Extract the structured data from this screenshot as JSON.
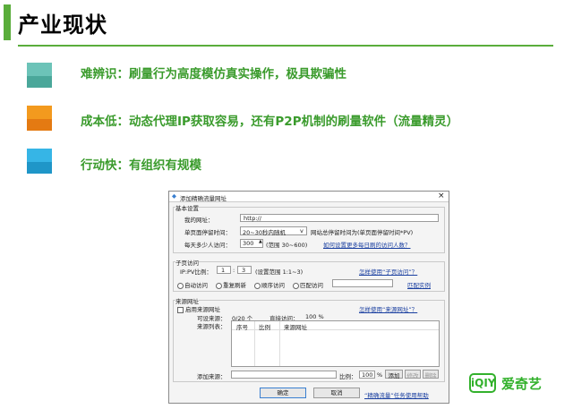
{
  "slide": {
    "title": "产业现状",
    "bullets": [
      {
        "text": "难辨识：刷量行为高度模仿真实操作，极具欺骗性",
        "color_top": "#6cc3b8",
        "color_bottom": "#4aa79a"
      },
      {
        "text": "成本低：动态代理IP获取容易，还有P2P机制的刷量软件（流量精灵）",
        "color_top": "#f39a1e",
        "color_bottom": "#e47a12"
      },
      {
        "text": "行动快：有组织有规模",
        "color_top": "#36b5e6",
        "color_bottom": "#1f96c8"
      }
    ],
    "accent": "#5aad3b"
  },
  "dialog": {
    "title": "添加精确流量网址",
    "close": "×",
    "basic": {
      "legend": "基本设置",
      "url_label": "我的网址：",
      "url_value": "http://",
      "stay_label": "单页面停留时间：",
      "stay_value": "20~30秒内随机",
      "stay_note": "网站总停留时间为(单页面停留时间*PV)",
      "visits_label": "每天多少人访问：",
      "visits_value": "300",
      "visits_range": "(范围 30~600)",
      "visits_link": "如何设置更多每日刷的访问人数？"
    },
    "sub": {
      "legend": "子页访问",
      "ipv_label": "IP:PV比例：",
      "ip_value": "1",
      "colon": ":",
      "pv_value": "3",
      "ipv_range": "(设置范围 1:1~3)",
      "howto_link": "怎样使用“子页访问”？",
      "radios": [
        "自动访问",
        "重复刷新",
        "顺序访问",
        "匹配访问"
      ],
      "match_link": "匹配实例"
    },
    "source": {
      "legend": "来源网址",
      "enable_label": "启用来源网址",
      "howto_link": "怎样使用“来源网址”？",
      "count_label": "可设来源：",
      "count_value": "0/20 个",
      "direct_label": "直接访问：",
      "direct_value": "100 %",
      "list_label": "来源列表：",
      "columns": [
        "序号",
        "比例",
        "来源网址"
      ],
      "add_label": "添加来源：",
      "ratio_label": "比例：",
      "ratio_value": "100",
      "ratio_unit": "%",
      "add_button": "添加",
      "modify_button": "修改",
      "delete_button": "删除"
    },
    "ok_button": "确定",
    "cancel_button": "取消",
    "help_link": "“精确流量”任务使用帮助"
  },
  "logo": {
    "box_text": "iQIY",
    "text": "爱奇艺",
    "color": "#33b12c"
  }
}
